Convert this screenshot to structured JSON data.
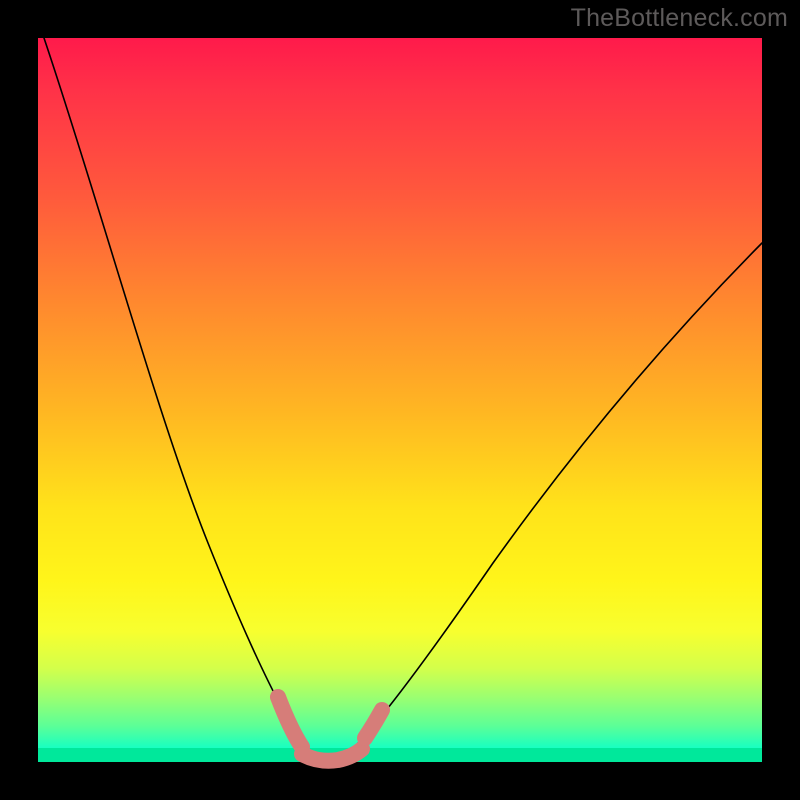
{
  "watermark": "TheBottleneck.com",
  "chart_data": {
    "type": "line",
    "title": "",
    "xlabel": "",
    "ylabel": "",
    "xlim": [
      0,
      100
    ],
    "ylim": [
      0,
      100
    ],
    "background_gradient": {
      "top_color": "#ff1a4b",
      "mid_color": "#ffe31a",
      "bottom_color": "#00ffb4",
      "comment": "red=high bottleneck, green=low bottleneck"
    },
    "series": [
      {
        "name": "left-curve",
        "x": [
          1,
          8,
          15,
          22,
          26,
          30,
          33,
          35,
          37,
          38.5,
          40
        ],
        "y": [
          100,
          78,
          56,
          32,
          20,
          10,
          5,
          2,
          0.8,
          0.2,
          0
        ]
      },
      {
        "name": "right-curve",
        "x": [
          40,
          42,
          45,
          50,
          58,
          68,
          80,
          92,
          100
        ],
        "y": [
          0,
          0.5,
          3,
          10,
          23,
          39,
          54,
          66,
          72
        ]
      },
      {
        "name": "highlight-region",
        "comment": "thick salmon overlay marking optimal zone near minimum",
        "x": [
          33,
          35,
          37,
          38.5,
          40,
          42,
          44,
          46
        ],
        "y": [
          5,
          2,
          0.8,
          0.2,
          0,
          0.5,
          2,
          5
        ]
      }
    ]
  }
}
